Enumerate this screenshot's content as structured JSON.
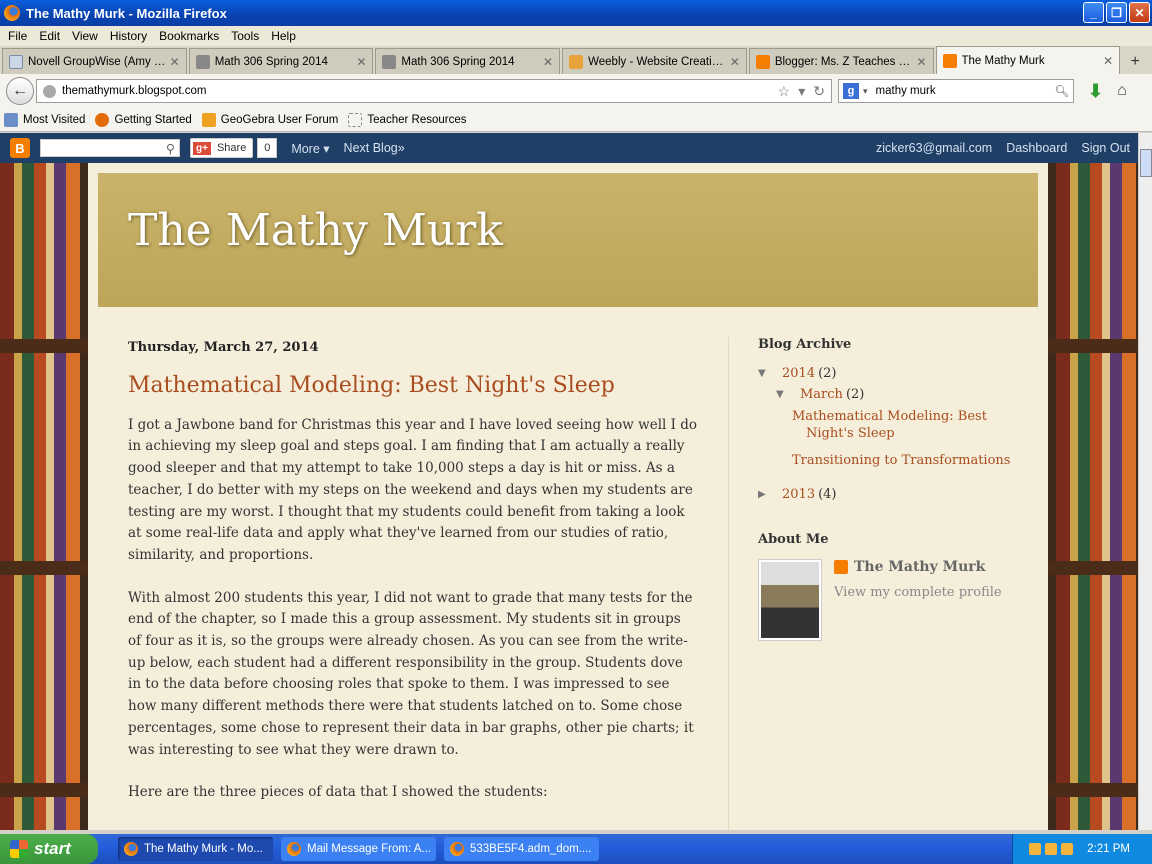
{
  "window": {
    "title": "The Mathy Murk - Mozilla Firefox"
  },
  "menu": [
    "File",
    "Edit",
    "View",
    "History",
    "Bookmarks",
    "Tools",
    "Help"
  ],
  "tabs": [
    {
      "label": "Novell GroupWise (Amy Zim...",
      "icon": "mail-icon"
    },
    {
      "label": "Math 306 Spring 2014",
      "icon": "page-icon"
    },
    {
      "label": "Math 306 Spring 2014",
      "icon": "page-icon"
    },
    {
      "label": "Weebly - Website Creation ...",
      "icon": "weebly-icon"
    },
    {
      "label": "Blogger: Ms. Z Teaches in M...",
      "icon": "blogger-icon"
    },
    {
      "label": "The Mathy Murk",
      "icon": "blogger-icon"
    }
  ],
  "nav": {
    "url": "themathymurk.blogspot.com",
    "search_value": "mathy murk"
  },
  "bookmarks": [
    "Most Visited",
    "Getting Started",
    "GeoGebra User Forum",
    "Teacher Resources"
  ],
  "blogbar": {
    "share_label": "Share",
    "share_count": "0",
    "more": "More",
    "next_blog": "Next Blog»",
    "email": "zicker63@gmail.com",
    "dashboard": "Dashboard",
    "sign_out": "Sign Out"
  },
  "blog": {
    "title": "The Mathy Murk",
    "post": {
      "date": "Thursday, March 27, 2014",
      "title": "Mathematical Modeling: Best Night's Sleep",
      "paragraphs": [
        "I got a Jawbone band for Christmas this year and I have loved seeing how well I do in achieving my sleep goal and steps goal.  I am finding that I am actually a really good sleeper and that my attempt to take 10,000 steps a day is hit or miss.  As a teacher, I do better with my steps on the weekend and days when my students are testing are my worst.  I thought that my students could benefit from taking a look at some real-life data and apply what they've learned from our studies of ratio, similarity, and proportions.",
        "With almost 200 students this year, I did not want to grade that many tests for the end of the chapter, so I made this a group assessment.  My students sit in groups of four as it is, so the groups were already chosen.  As you can see from the write-up below, each student had a different responsibility in the group.  Students dove in to the data before choosing roles that spoke to them.  I was impressed to see how many different methods there were that students latched on to.  Some chose percentages, some chose to represent their data in bar graphs, other pie charts; it was interesting to see what they were drawn to.",
        "Here are the three pieces of data that I showed the students:"
      ]
    },
    "archive": {
      "heading": "Blog Archive",
      "y2014": "2014",
      "y2014_count": "(2)",
      "month": "March",
      "month_count": "(2)",
      "posts": [
        "Mathematical Modeling: Best Night's Sleep",
        "Transitioning to Transformations"
      ],
      "y2013": "2013",
      "y2013_count": "(4)"
    },
    "about": {
      "heading": "About Me",
      "name": "The Mathy Murk",
      "view_profile": "View my complete profile"
    }
  },
  "taskbar": {
    "start": "start",
    "tasks": [
      "The Mathy Murk - Mo...",
      "Mail Message From: A...",
      "533BE5F4.adm_dom...."
    ],
    "time": "2:21 PM"
  }
}
